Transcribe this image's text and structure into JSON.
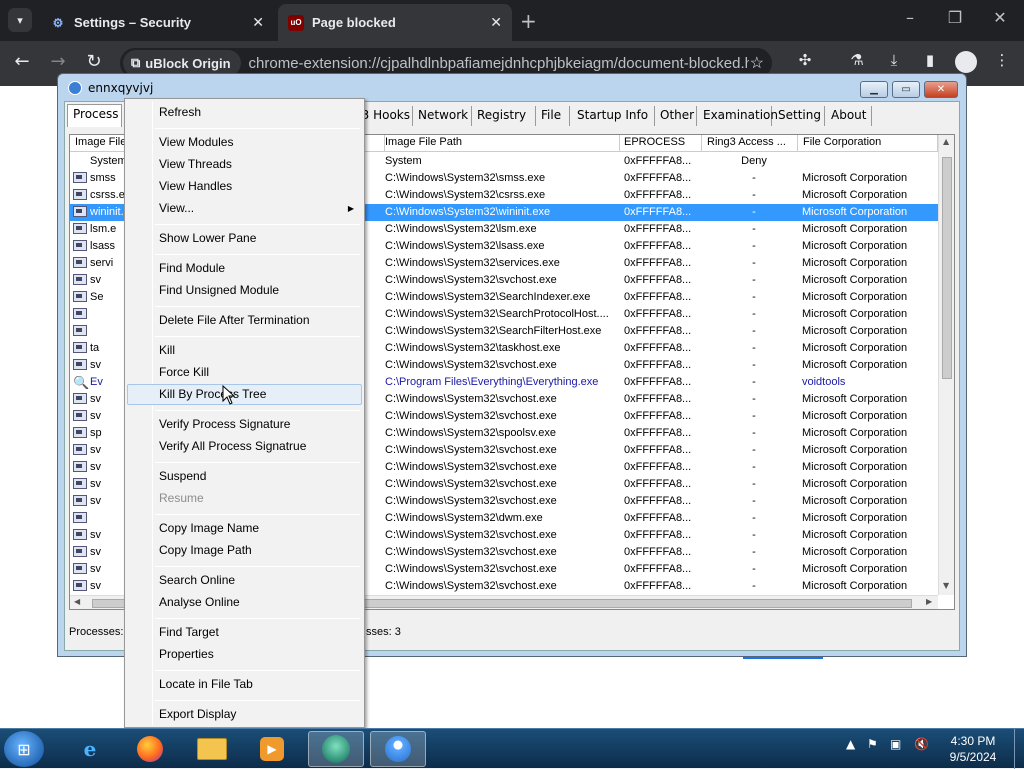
{
  "browser": {
    "tabs": [
      {
        "title": "Settings – Security",
        "icon": "gear-icon"
      },
      {
        "title": "Page blocked",
        "icon": "ublock-icon"
      }
    ],
    "extension_chip": "uBlock Origin",
    "url": "chrome-extension://cjpalhdlnbpafiamejdnhcphjbkeiagm/document-blocked.ht..."
  },
  "window": {
    "title": "ennxqyvjvj",
    "tabs": [
      "Process",
      "Ring3 Hooks",
      "Network",
      "Registry",
      "File",
      "Startup Info",
      "Other",
      "Examination",
      "Setting",
      "About"
    ]
  },
  "table": {
    "columns": [
      "Image File",
      "Image File Path",
      "EPROCESS",
      "Ring3 Access ...",
      "File Corporation"
    ],
    "rows": [
      {
        "name": "System",
        "path": "System",
        "eprocess": "0xFFFFFA8...",
        "access": "Deny",
        "corp": "",
        "icon": "none"
      },
      {
        "name": "smss",
        "path": "C:\\Windows\\System32\\smss.exe",
        "eprocess": "0xFFFFFA8...",
        "access": "-",
        "corp": "Microsoft Corporation",
        "icon": "process"
      },
      {
        "name": "csrss.e",
        "path": "C:\\Windows\\System32\\csrss.exe",
        "eprocess": "0xFFFFFA8...",
        "access": "-",
        "corp": "Microsoft Corporation",
        "icon": "process"
      },
      {
        "name": "wininit.",
        "path": "C:\\Windows\\System32\\wininit.exe",
        "eprocess": "0xFFFFFA8...",
        "access": "-",
        "corp": "Microsoft Corporation",
        "icon": "process",
        "selected": true
      },
      {
        "name": "lsm.e",
        "path": "C:\\Windows\\System32\\lsm.exe",
        "eprocess": "0xFFFFFA8...",
        "access": "-",
        "corp": "Microsoft Corporation",
        "icon": "process"
      },
      {
        "name": "lsass",
        "path": "C:\\Windows\\System32\\lsass.exe",
        "eprocess": "0xFFFFFA8...",
        "access": "-",
        "corp": "Microsoft Corporation",
        "icon": "process"
      },
      {
        "name": "servi",
        "path": "C:\\Windows\\System32\\services.exe",
        "eprocess": "0xFFFFFA8...",
        "access": "-",
        "corp": "Microsoft Corporation",
        "icon": "process"
      },
      {
        "name": "sv",
        "path": "C:\\Windows\\System32\\svchost.exe",
        "eprocess": "0xFFFFFA8...",
        "access": "-",
        "corp": "Microsoft Corporation",
        "icon": "process"
      },
      {
        "name": "Se",
        "path": "C:\\Windows\\System32\\SearchIndexer.exe",
        "eprocess": "0xFFFFFA8...",
        "access": "-",
        "corp": "Microsoft Corporation",
        "icon": "process"
      },
      {
        "name": "",
        "path": "C:\\Windows\\System32\\SearchProtocolHost....",
        "eprocess": "0xFFFFFA8...",
        "access": "-",
        "corp": "Microsoft Corporation",
        "icon": "process"
      },
      {
        "name": "",
        "path": "C:\\Windows\\System32\\SearchFilterHost.exe",
        "eprocess": "0xFFFFFA8...",
        "access": "-",
        "corp": "Microsoft Corporation",
        "icon": "process"
      },
      {
        "name": "ta",
        "path": "C:\\Windows\\System32\\taskhost.exe",
        "eprocess": "0xFFFFFA8...",
        "access": "-",
        "corp": "Microsoft Corporation",
        "icon": "process"
      },
      {
        "name": "sv",
        "path": "C:\\Windows\\System32\\svchost.exe",
        "eprocess": "0xFFFFFA8...",
        "access": "-",
        "corp": "Microsoft Corporation",
        "icon": "process"
      },
      {
        "name": "Ev",
        "path": "C:\\Program Files\\Everything\\Everything.exe",
        "eprocess": "0xFFFFFA8...",
        "access": "-",
        "corp": "voidtools",
        "icon": "magnifier",
        "blue": true
      },
      {
        "name": "sv",
        "path": "C:\\Windows\\System32\\svchost.exe",
        "eprocess": "0xFFFFFA8...",
        "access": "-",
        "corp": "Microsoft Corporation",
        "icon": "process"
      },
      {
        "name": "sv",
        "path": "C:\\Windows\\System32\\svchost.exe",
        "eprocess": "0xFFFFFA8...",
        "access": "-",
        "corp": "Microsoft Corporation",
        "icon": "process"
      },
      {
        "name": "sp",
        "path": "C:\\Windows\\System32\\spoolsv.exe",
        "eprocess": "0xFFFFFA8...",
        "access": "-",
        "corp": "Microsoft Corporation",
        "icon": "process"
      },
      {
        "name": "sv",
        "path": "C:\\Windows\\System32\\svchost.exe",
        "eprocess": "0xFFFFFA8...",
        "access": "-",
        "corp": "Microsoft Corporation",
        "icon": "process"
      },
      {
        "name": "sv",
        "path": "C:\\Windows\\System32\\svchost.exe",
        "eprocess": "0xFFFFFA8...",
        "access": "-",
        "corp": "Microsoft Corporation",
        "icon": "process"
      },
      {
        "name": "sv",
        "path": "C:\\Windows\\System32\\svchost.exe",
        "eprocess": "0xFFFFFA8...",
        "access": "-",
        "corp": "Microsoft Corporation",
        "icon": "process"
      },
      {
        "name": "sv",
        "path": "C:\\Windows\\System32\\svchost.exe",
        "eprocess": "0xFFFFFA8...",
        "access": "-",
        "corp": "Microsoft Corporation",
        "icon": "process"
      },
      {
        "name": "",
        "path": "C:\\Windows\\System32\\dwm.exe",
        "eprocess": "0xFFFFFA8...",
        "access": "-",
        "corp": "Microsoft Corporation",
        "icon": "process"
      },
      {
        "name": "sv",
        "path": "C:\\Windows\\System32\\svchost.exe",
        "eprocess": "0xFFFFFA8...",
        "access": "-",
        "corp": "Microsoft Corporation",
        "icon": "process"
      },
      {
        "name": "sv",
        "path": "C:\\Windows\\System32\\svchost.exe",
        "eprocess": "0xFFFFFA8...",
        "access": "-",
        "corp": "Microsoft Corporation",
        "icon": "process"
      },
      {
        "name": "sv",
        "path": "C:\\Windows\\System32\\svchost.exe",
        "eprocess": "0xFFFFFA8...",
        "access": "-",
        "corp": "Microsoft Corporation",
        "icon": "process"
      },
      {
        "name": "sv",
        "path": "C:\\Windows\\System32\\svchost.exe",
        "eprocess": "0xFFFFFA8...",
        "access": "-",
        "corp": "Microsoft Corporation",
        "icon": "process"
      },
      {
        "name": "",
        "path": "C:\\Windows\\System32\\dllhost.exe",
        "eprocess": "0xFFFFFA8...",
        "access": "-",
        "corp": "Microsoft Corporation",
        "icon": "process"
      }
    ]
  },
  "status": {
    "processes_label": "Processes:",
    "right_text": "sses: 3"
  },
  "context_menu": {
    "groups": [
      [
        {
          "label": "Refresh"
        }
      ],
      [
        {
          "label": "View Modules"
        },
        {
          "label": "View Threads"
        },
        {
          "label": "View Handles"
        },
        {
          "label": "View...",
          "submenu": true
        }
      ],
      [
        {
          "label": "Show Lower Pane"
        }
      ],
      [
        {
          "label": "Find Module"
        },
        {
          "label": "Find Unsigned Module"
        }
      ],
      [
        {
          "label": "Delete File After Termination"
        }
      ],
      [
        {
          "label": "Kill"
        },
        {
          "label": "Force Kill"
        },
        {
          "label": "Kill By Process Tree",
          "hovered": true
        }
      ],
      [
        {
          "label": "Verify Process Signature"
        },
        {
          "label": "Verify All Process Signatrue"
        }
      ],
      [
        {
          "label": "Suspend"
        },
        {
          "label": "Resume",
          "disabled": true
        }
      ],
      [
        {
          "label": "Copy Image Name"
        },
        {
          "label": "Copy Image Path"
        }
      ],
      [
        {
          "label": "Search Online"
        },
        {
          "label": "Analyse Online"
        }
      ],
      [
        {
          "label": "Find Target"
        },
        {
          "label": "Properties"
        }
      ],
      [
        {
          "label": "Locate in File Tab"
        }
      ],
      [
        {
          "label": "Export Display"
        }
      ]
    ]
  },
  "taskbar": {
    "apps": [
      "ie-icon",
      "firefox-icon",
      "explorer-icon",
      "media-player-icon",
      "app-active-icon",
      "app-icon"
    ],
    "time": "4:30 PM",
    "date": "9/5/2024"
  }
}
